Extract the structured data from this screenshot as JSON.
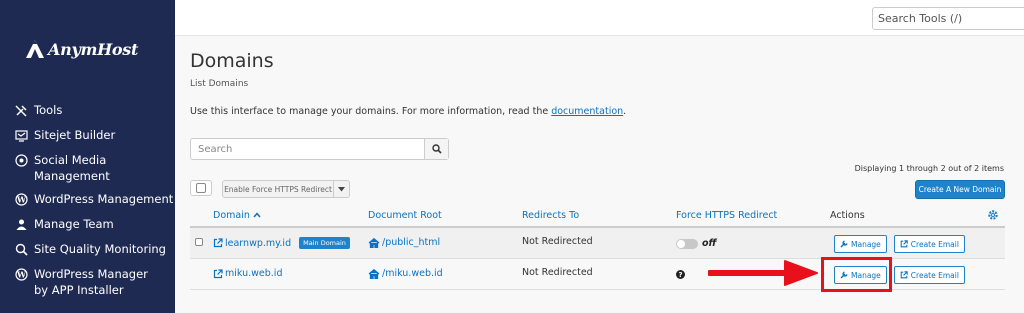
{
  "brand": {
    "name": "AnymHost"
  },
  "sidebar": {
    "items": [
      {
        "label": "Tools",
        "icon": "tools-icon"
      },
      {
        "label": "Sitejet Builder",
        "icon": "sitejet-icon"
      },
      {
        "label": "Social Media Management",
        "icon": "social-media-icon"
      },
      {
        "label": "WordPress Management",
        "icon": "wordpress-icon"
      },
      {
        "label": "Manage Team",
        "icon": "team-icon"
      },
      {
        "label": "Site Quality Monitoring",
        "icon": "monitoring-icon"
      },
      {
        "label": "WordPress Manager by APP Installer",
        "icon": "wordpress-icon"
      }
    ]
  },
  "topbar": {
    "search_placeholder": "Search Tools (/)"
  },
  "page": {
    "title": "Domains",
    "subtitle": "List Domains",
    "intro_text": "Use this interface to manage your domains. For more information, read the ",
    "intro_link": "documentation",
    "intro_end": "."
  },
  "search": {
    "placeholder": "Search"
  },
  "display_count": "Displaying 1 through 2 out of 2 items",
  "toolbar": {
    "https_button": "Enable Force HTTPS Redirect",
    "create_button": "Create A New Domain"
  },
  "table": {
    "headers": {
      "domain": "Domain",
      "document_root": "Document Root",
      "redirects_to": "Redirects To",
      "force_https": "Force HTTPS Redirect",
      "actions": "Actions"
    },
    "rows": [
      {
        "domain": "learnwp.my.id",
        "badge": "Main Domain",
        "document_root": "/public_html",
        "redirects_to": "Not Redirected",
        "force_https": "off",
        "manage": "Manage",
        "create_email": "Create Email"
      },
      {
        "domain": "miku.web.id",
        "badge": "",
        "document_root": "/miku.web.id",
        "redirects_to": "Not Redirected",
        "force_https": "?",
        "manage": "Manage",
        "create_email": "Create Email"
      }
    ]
  },
  "colors": {
    "sidebar_bg": "#1f2a53",
    "accent": "#1f83cc",
    "link": "#0b72c2",
    "highlight": "#e8101a"
  }
}
